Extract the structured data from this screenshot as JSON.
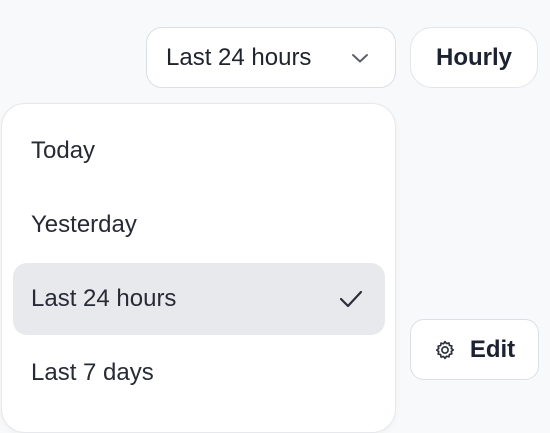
{
  "range_selector": {
    "selected_label": "Last 24 hours",
    "chevron_icon": "chevron-down-icon"
  },
  "granularity_button": {
    "label": "Hourly"
  },
  "edit_button": {
    "label": "Edit",
    "icon": "gear-icon"
  },
  "dropdown": {
    "items": [
      {
        "label": "Today"
      },
      {
        "label": "Yesterday"
      },
      {
        "label": "Last 24 hours",
        "selected": true,
        "icon": "check-icon"
      },
      {
        "label": "Last 7 days"
      }
    ]
  },
  "colors": {
    "background": "#f8f9fa",
    "surface": "#ffffff",
    "selected_item": "#e8e9ec",
    "text": "#1c2230",
    "border": "#dcdfe3"
  }
}
